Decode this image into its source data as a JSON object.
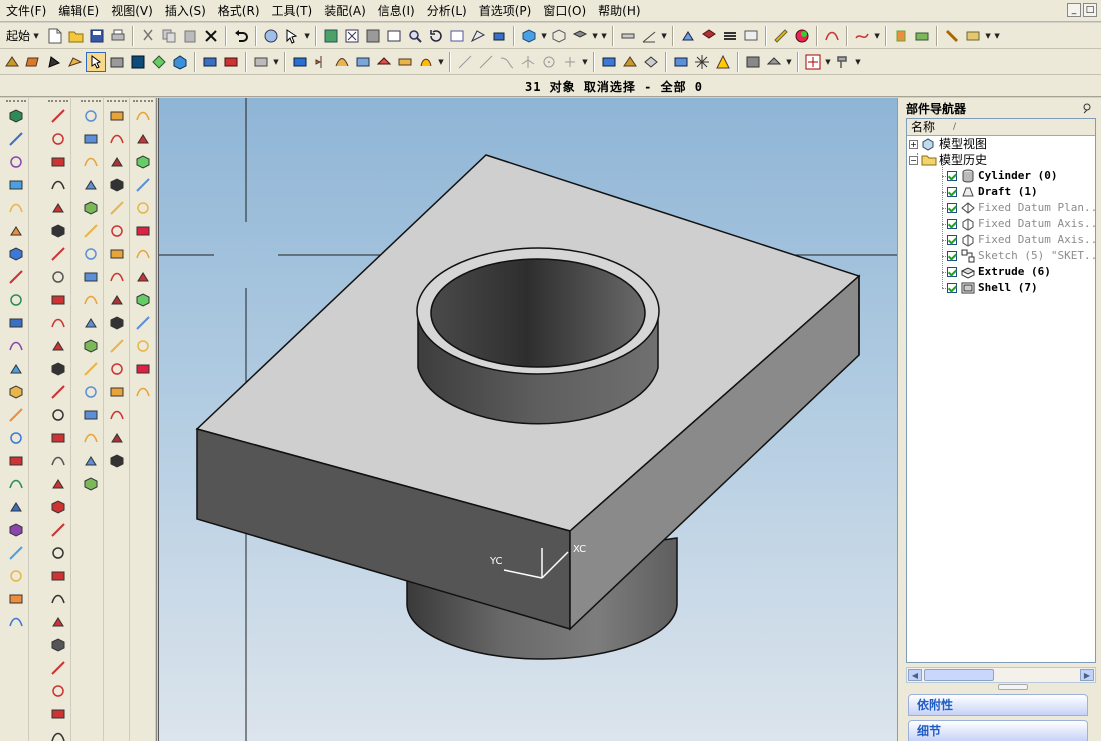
{
  "menubar": {
    "items": [
      "文件(F)",
      "编辑(E)",
      "视图(V)",
      "插入(S)",
      "格式(R)",
      "工具(T)",
      "装配(A)",
      "信息(I)",
      "分析(L)",
      "首选项(P)",
      "窗口(O)",
      "帮助(H)"
    ],
    "window_controls": [
      "_",
      "□"
    ]
  },
  "toolbar": {
    "start_label": "起始"
  },
  "status": {
    "selection_text": "31 对象  取消选择  - 全部 0"
  },
  "viewport": {
    "background_top": "#8fb5d6",
    "background_bottom": "#dce4ec",
    "axis_labels": {
      "yc": "YC",
      "xc": "XC"
    }
  },
  "navigator": {
    "title": "部件导航器",
    "column_header": "名称",
    "tree": {
      "model_views": "模型视图",
      "model_history": "模型历史",
      "features": [
        {
          "label": "Cylinder (0)",
          "active": true,
          "icon": "cylinder-icon"
        },
        {
          "label": "Draft (1)",
          "active": true,
          "icon": "draft-icon"
        },
        {
          "label": "Fixed Datum Plan...",
          "active": false,
          "icon": "datum-plane-icon"
        },
        {
          "label": "Fixed Datum Axis...",
          "active": false,
          "icon": "datum-axis-icon"
        },
        {
          "label": "Fixed Datum Axis...",
          "active": false,
          "icon": "datum-axis-icon"
        },
        {
          "label": "Sketch (5) \"SKET...",
          "active": false,
          "icon": "sketch-icon"
        },
        {
          "label": "Extrude (6)",
          "active": true,
          "icon": "extrude-icon"
        },
        {
          "label": "Shell (7)",
          "active": true,
          "icon": "shell-icon"
        }
      ]
    },
    "panels": {
      "dependencies": "依附性",
      "details": "细节"
    }
  },
  "colors": {
    "ui_face": "#ece9d8",
    "model_top": "#cfcfcf",
    "model_side_dark": "#555555",
    "panel_blue": "#215dc6"
  }
}
